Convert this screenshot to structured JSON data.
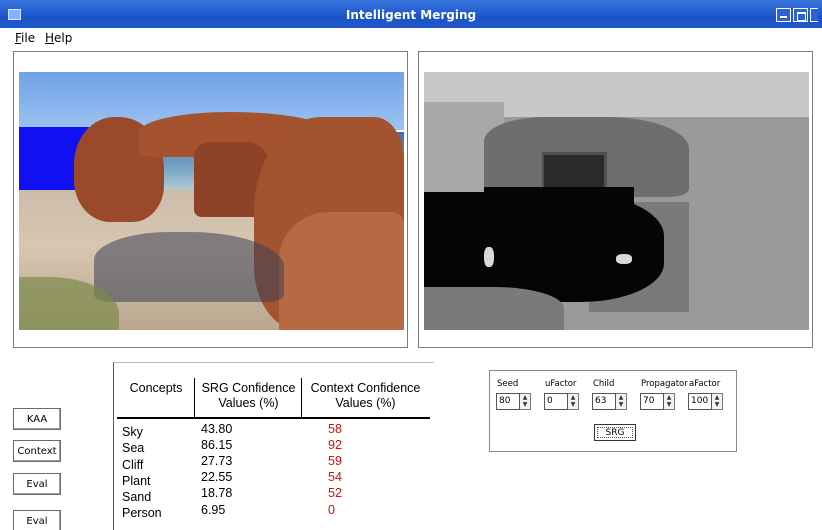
{
  "window": {
    "title": "Intelligent Merging"
  },
  "menu": {
    "file": "File",
    "help": "Help"
  },
  "buttons": {
    "kaa": "KAA",
    "context": "Context",
    "eval1": "Eval",
    "eval2": "Eval",
    "srg": "SRG"
  },
  "table": {
    "headers": {
      "concepts": "Concepts",
      "srg": "SRG Confidence Values (%)",
      "context": "Context Confidence Values (%)"
    },
    "rows": [
      {
        "concept": "Sky",
        "srg": "43.80",
        "context": "58"
      },
      {
        "concept": "Sea",
        "srg": "86.15",
        "context": "92"
      },
      {
        "concept": "Cliff",
        "srg": "27.73",
        "context": "59"
      },
      {
        "concept": "Plant",
        "srg": "22.55",
        "context": "54"
      },
      {
        "concept": "Sand",
        "srg": "18.78",
        "context": "52"
      },
      {
        "concept": "Person",
        "srg": "6.95",
        "context": "0"
      }
    ]
  },
  "params": [
    {
      "label": "Seed",
      "value": "80"
    },
    {
      "label": "uFactor",
      "value": "0"
    },
    {
      "label": "Child",
      "value": "63"
    },
    {
      "label": "Propagator",
      "value": "70"
    },
    {
      "label": "aFactor",
      "value": "100"
    }
  ]
}
